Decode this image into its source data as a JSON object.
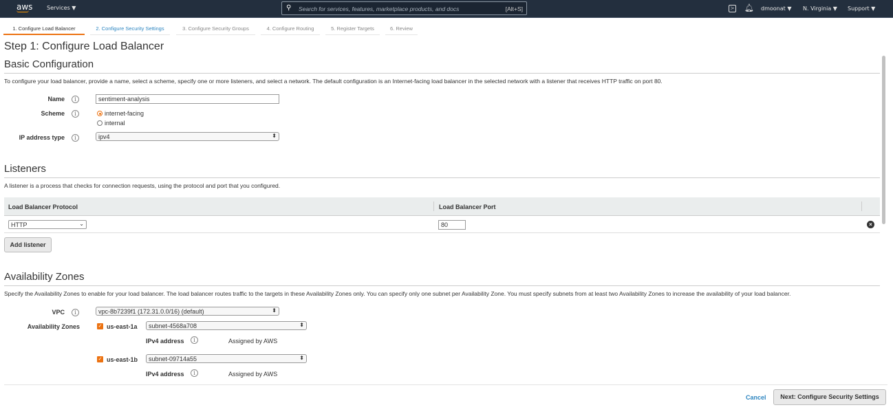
{
  "topbar": {
    "logo": "aws",
    "services": "Services",
    "search_placeholder": "Search for services, features, marketplace products, and docs",
    "search_shortcut": "[Alt+S]",
    "user": "dmoonat",
    "region": "N. Virginia",
    "support": "Support"
  },
  "wizard_tabs": [
    "1. Configure Load Balancer",
    "2. Configure Security Settings",
    "3. Configure Security Groups",
    "4. Configure Routing",
    "5. Register Targets",
    "6. Review"
  ],
  "page_title": "Step 1: Configure Load Balancer",
  "basic": {
    "title": "Basic Configuration",
    "description": "To configure your load balancer, provide a name, select a scheme, specify one or more listeners, and select a network. The default configuration is an Internet-facing load balancer in the selected network with a listener that receives HTTP traffic on port 80.",
    "name_label": "Name",
    "name_value": "sentiment-analysis",
    "scheme_label": "Scheme",
    "scheme_options": [
      "internet-facing",
      "internal"
    ],
    "scheme_selected": "internet-facing",
    "ip_label": "IP address type",
    "ip_value": "ipv4"
  },
  "listeners": {
    "title": "Listeners",
    "description": "A listener is a process that checks for connection requests, using the protocol and port that you configured.",
    "col_protocol": "Load Balancer Protocol",
    "col_port": "Load Balancer Port",
    "protocol": "HTTP",
    "port": "80",
    "add_label": "Add listener"
  },
  "az": {
    "title": "Availability Zones",
    "description": "Specify the Availability Zones to enable for your load balancer. The load balancer routes traffic to the targets in these Availability Zones only. You can specify only one subnet per Availability Zone. You must specify subnets from at least two Availability Zones to increase the availability of your load balancer.",
    "vpc_label": "VPC",
    "vpc_value": "vpc-8b7239f1 (172.31.0.0/16) (default)",
    "zones_label": "Availability Zones",
    "zones": [
      {
        "name": "us-east-1a",
        "subnet": "subnet-4568a708",
        "ipv4_label": "IPv4 address",
        "ipv4_value": "Assigned by AWS",
        "checked": true
      },
      {
        "name": "us-east-1b",
        "subnet": "subnet-09714a55",
        "ipv4_label": "IPv4 address",
        "ipv4_value": "Assigned by AWS",
        "checked": true
      }
    ]
  },
  "footer": {
    "cancel": "Cancel",
    "next": "Next: Configure Security Settings"
  },
  "colors": {
    "accent": "#ec7211",
    "link": "#2e86c1",
    "topbar": "#232f3e"
  }
}
